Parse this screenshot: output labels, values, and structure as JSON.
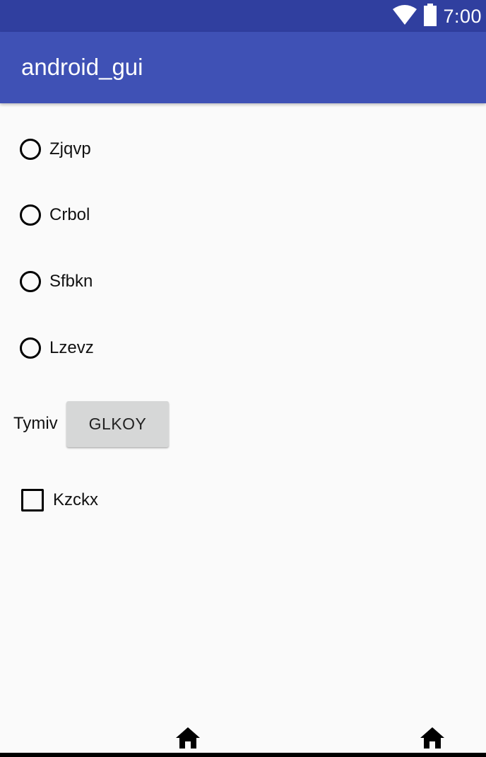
{
  "status_bar": {
    "time": "7:00",
    "icons": [
      "wifi-icon",
      "battery-icon"
    ],
    "background": "#303f9f"
  },
  "app_bar": {
    "title": "android_gui",
    "background": "#3f51b5"
  },
  "radio_options": [
    {
      "label": "Zjqvp",
      "checked": false
    },
    {
      "label": "Crbol",
      "checked": false
    },
    {
      "label": "Sfbkn",
      "checked": false
    },
    {
      "label": "Lzevz",
      "checked": false
    }
  ],
  "tymiv": {
    "label": "Tymiv",
    "button_label": "GLKOY"
  },
  "checkbox": {
    "label": "Kzckx",
    "checked": false
  },
  "bottom_nav": {
    "icons": [
      "home-icon",
      "home-icon"
    ]
  }
}
